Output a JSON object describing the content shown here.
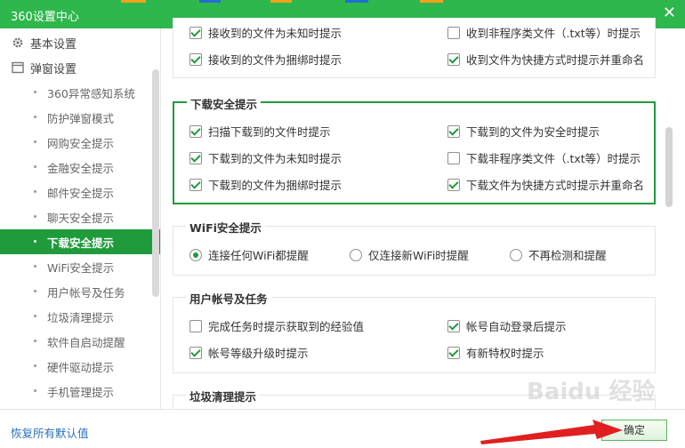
{
  "window": {
    "title": "360设置中心",
    "close_glyph": "✕"
  },
  "sidebar": {
    "groups": [
      {
        "label": "基本设置",
        "icon": "gear-icon"
      },
      {
        "label": "弹窗设置",
        "icon": "window-icon"
      }
    ],
    "items": [
      {
        "label": "360异常感知系统"
      },
      {
        "label": "防护弹窗模式"
      },
      {
        "label": "网购安全提示"
      },
      {
        "label": "金融安全提示"
      },
      {
        "label": "邮件安全提示"
      },
      {
        "label": "聊天安全提示"
      },
      {
        "label": "下载安全提示",
        "active": true
      },
      {
        "label": "WiFi安全提示"
      },
      {
        "label": "用户帐号及任务"
      },
      {
        "label": "垃圾清理提示"
      },
      {
        "label": "软件自启动提醒"
      },
      {
        "label": "硬件驱动提示"
      },
      {
        "label": "手机管理提示"
      }
    ]
  },
  "top_partial": {
    "options": [
      {
        "label": "接收到的文件为未知时提示",
        "checked": true
      },
      {
        "label": "收到非程序类文件（.txt等）时提示",
        "checked": false
      },
      {
        "label": "接收到的文件为捆绑时提示",
        "checked": true
      },
      {
        "label": "收到文件为快捷方式时提示并重命名",
        "checked": true
      }
    ]
  },
  "download_section": {
    "title": "下载安全提示",
    "options": [
      {
        "label": "扫描下载到的文件时提示",
        "checked": true
      },
      {
        "label": "下载到的文件为安全时提示",
        "checked": true
      },
      {
        "label": "下载到的文件为未知时提示",
        "checked": true
      },
      {
        "label": "下载非程序类文件（.txt等）时提示",
        "checked": false
      },
      {
        "label": "下载到的文件为捆绑时提示",
        "checked": true
      },
      {
        "label": "下载文件为快捷方式时提示并重命名",
        "checked": true
      }
    ]
  },
  "wifi_section": {
    "title": "WiFi安全提示",
    "options": [
      {
        "label": "连接任何WiFi都提醒",
        "selected": true
      },
      {
        "label": "仅连接新WiFi时提醒",
        "selected": false
      },
      {
        "label": "不再检测和提醒",
        "selected": false
      }
    ]
  },
  "account_section": {
    "title": "用户帐号及任务",
    "options": [
      {
        "label": "完成任务时提示获取到的经验值",
        "checked": false
      },
      {
        "label": "帐号自动登录后提示",
        "checked": true
      },
      {
        "label": "帐号等级升级时提示",
        "checked": true
      },
      {
        "label": "有新特权时提示",
        "checked": true
      }
    ]
  },
  "junk_section": {
    "title": "垃圾清理提示"
  },
  "footer": {
    "reset_label": "恢复所有默认值",
    "ok_label": "确定"
  },
  "watermark": "Baidu 经验",
  "colors": {
    "title_bar": "#2eb74c",
    "accent": "#1f9b3c",
    "link": "#2d6fbf"
  }
}
